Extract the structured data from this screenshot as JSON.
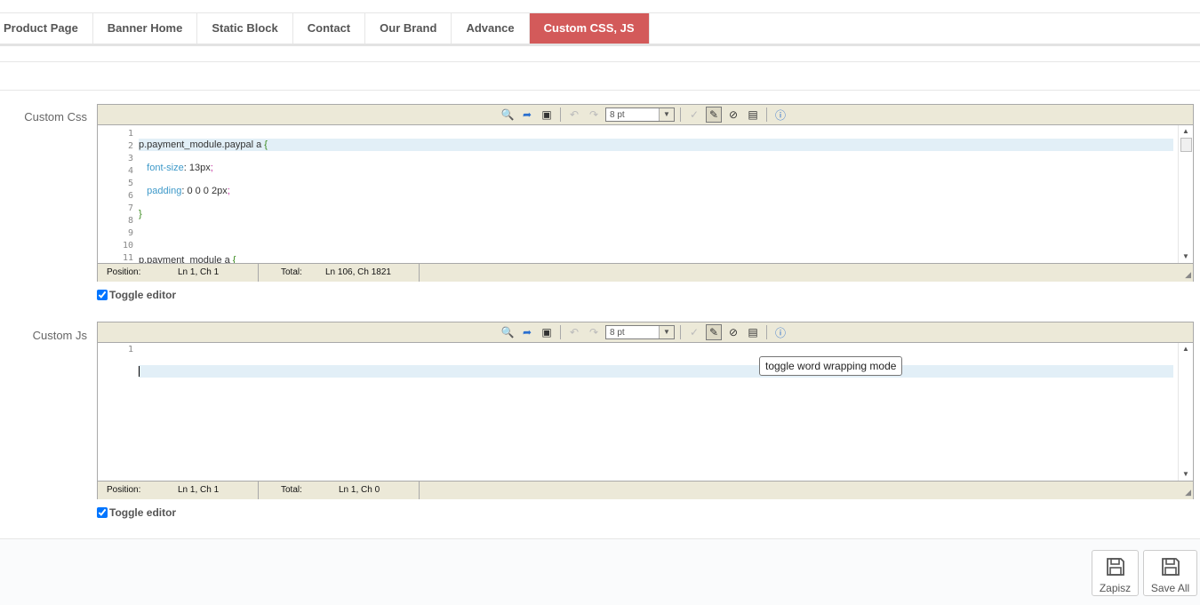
{
  "tabs": [
    {
      "label": "Product Page",
      "active": false
    },
    {
      "label": "Banner Home",
      "active": false
    },
    {
      "label": "Static Block",
      "active": false
    },
    {
      "label": "Contact",
      "active": false
    },
    {
      "label": "Our Brand",
      "active": false
    },
    {
      "label": "Advance",
      "active": false
    },
    {
      "label": "Custom CSS, JS",
      "active": true
    }
  ],
  "css_editor": {
    "label": "Custom Css",
    "font_size": "8 pt",
    "line_numbers": [
      "1",
      "2",
      "3",
      "4",
      "5",
      "6",
      "7",
      "8",
      "9",
      "10",
      "11"
    ],
    "status": {
      "position_label": "Position:",
      "position_value": "Ln 1, Ch 1",
      "total_label": "Total:",
      "total_value": "Ln 106, Ch 1821"
    },
    "toggle_label": "Toggle editor"
  },
  "js_editor": {
    "label": "Custom Js",
    "font_size": "8 pt",
    "line_numbers": [
      "1"
    ],
    "status": {
      "position_label": "Position:",
      "position_value": "Ln 1, Ch 1",
      "total_label": "Total:",
      "total_value": "Ln 1, Ch 0"
    },
    "toggle_label": "Toggle editor"
  },
  "tooltip": "toggle word wrapping mode",
  "buttons": {
    "save": "Zapisz",
    "save_all": "Save All"
  },
  "colors": {
    "active_tab": "#d35a5a",
    "toolbar_bg": "#ece9d8"
  },
  "icons": [
    "search-icon",
    "goto-line-icon",
    "fullscreen-icon",
    "undo-icon",
    "redo-icon",
    "spellcheck-icon",
    "highlight-icon",
    "reset-icon",
    "word-wrap-icon",
    "help-icon",
    "save-icon"
  ]
}
